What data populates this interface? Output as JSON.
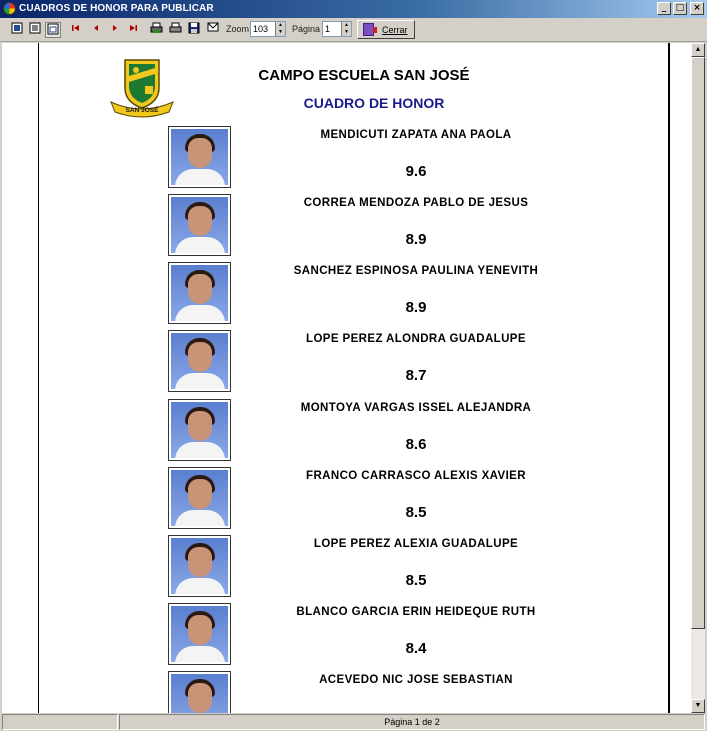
{
  "window": {
    "title": "CUADROS DE HONOR PARA PUBLICAR",
    "minimize_glyph": "_",
    "maximize_glyph": "□",
    "close_glyph": "×"
  },
  "toolbar": {
    "zoom_label": "Zoom",
    "zoom_value": "103",
    "page_label": "Página",
    "page_value": "1",
    "close_label": "Cerrar",
    "icons": [
      "single-page-icon",
      "multi-page-icon",
      "fit-page-icon",
      "first-page-icon",
      "prev-page-icon",
      "next-page-icon",
      "last-page-icon",
      "print-setup-icon",
      "print-icon",
      "save-icon",
      "email-icon"
    ]
  },
  "report": {
    "school_name": "CAMPO ESCUELA SAN JOSÉ",
    "subtitle": "CUADRO DE HONOR",
    "logo_text": "SAN JOSÉ",
    "students": [
      {
        "name": "MENDICUTI ZAPATA ANA PAOLA",
        "grade": "9.6"
      },
      {
        "name": "CORREA MENDOZA PABLO DE JESUS",
        "grade": "8.9"
      },
      {
        "name": "SANCHEZ ESPINOSA PAULINA YENEVITH",
        "grade": "8.9"
      },
      {
        "name": "LOPE PEREZ ALONDRA GUADALUPE",
        "grade": "8.7"
      },
      {
        "name": "MONTOYA VARGAS ISSEL ALEJANDRA",
        "grade": "8.6"
      },
      {
        "name": "FRANCO CARRASCO ALEXIS XAVIER",
        "grade": "8.5"
      },
      {
        "name": "LOPE PEREZ ALEXIA GUADALUPE",
        "grade": "8.5"
      },
      {
        "name": "BLANCO GARCIA ERIN HEIDEQUE RUTH",
        "grade": "8.4"
      },
      {
        "name": "ACEVEDO NIC JOSE SEBASTIAN",
        "grade": ""
      }
    ]
  },
  "statusbar": {
    "page_info": "Página 1 de 2"
  },
  "colors": {
    "title_bar": "#0a246a",
    "subtitle": "#1a1a8c",
    "photo_bg": "#5a7fcf"
  }
}
